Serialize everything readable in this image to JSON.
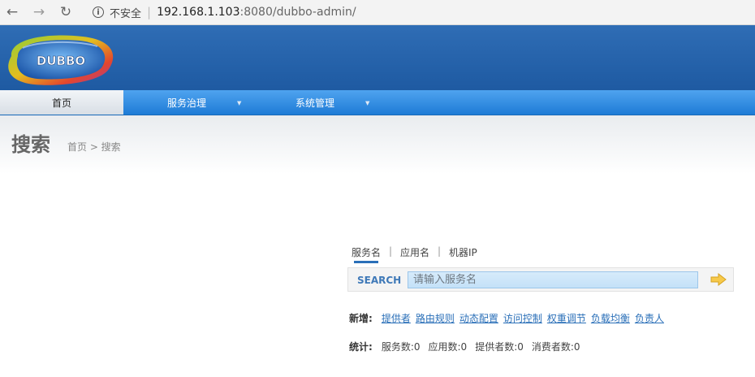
{
  "browser": {
    "insecure_label": "不安全",
    "url_host": "192.168.1.103",
    "url_rest": ":8080/dubbo-admin/"
  },
  "logo": {
    "text": "DUBBO"
  },
  "nav": {
    "home": "首页",
    "service_governance": "服务治理",
    "system_management": "系统管理"
  },
  "page": {
    "title": "搜索",
    "breadcrumb": "首页 > 搜索"
  },
  "search": {
    "tabs": [
      "服务名",
      "应用名",
      "机器IP"
    ],
    "tab_separator": "|",
    "label": "SEARCH",
    "placeholder": "请输入服务名"
  },
  "add": {
    "label": "新增:",
    "links": [
      "提供者",
      "路由规则",
      "动态配置",
      "访问控制",
      "权重调节",
      "负载均衡",
      "负责人"
    ]
  },
  "stats": {
    "label": "统计:",
    "items": [
      "服务数:0",
      "应用数:0",
      "提供者数:0",
      "消费者数:0"
    ]
  },
  "colors": {
    "header_blue": "#1e5aa2",
    "nav_blue": "#1e7bd6",
    "link_blue": "#2a6fb8",
    "search_label": "#3f79b8"
  }
}
